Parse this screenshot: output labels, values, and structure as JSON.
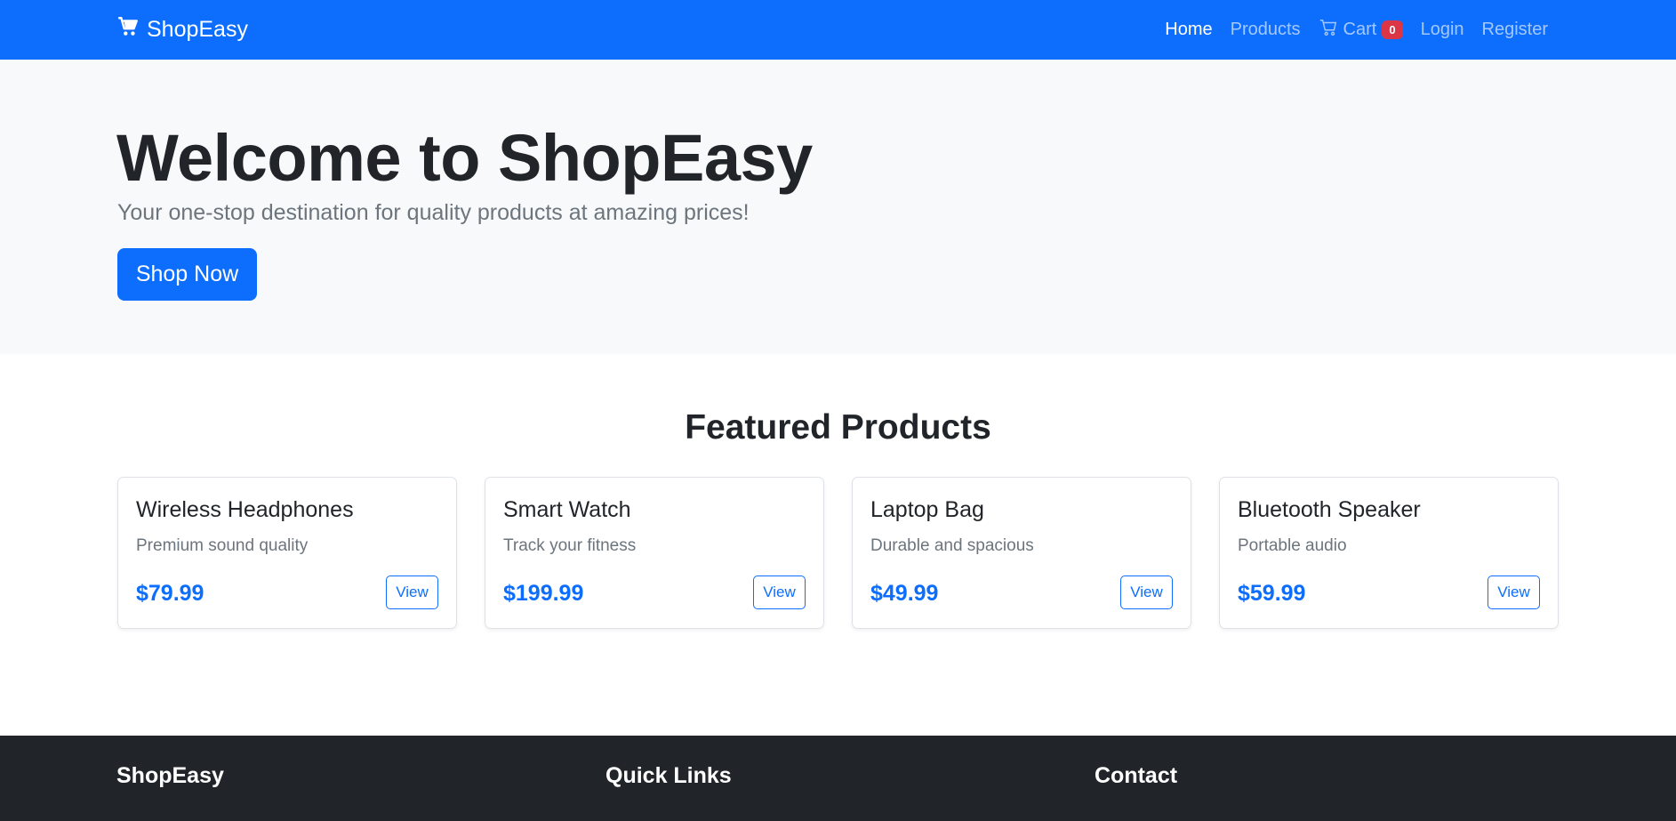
{
  "navbar": {
    "brand": "ShopEasy",
    "links": [
      {
        "label": "Home",
        "active": true
      },
      {
        "label": "Products",
        "active": false
      },
      {
        "label": "Cart",
        "active": false,
        "badge": "0"
      },
      {
        "label": "Login",
        "active": false
      },
      {
        "label": "Register",
        "active": false
      }
    ]
  },
  "hero": {
    "title": "Welcome to ShopEasy",
    "subtitle": "Your one-stop destination for quality products at amazing prices!",
    "cta": "Shop Now"
  },
  "featured": {
    "title": "Featured Products",
    "products": [
      {
        "name": "Wireless Headphones",
        "desc": "Premium sound quality",
        "price": "$79.99",
        "button": "View"
      },
      {
        "name": "Smart Watch",
        "desc": "Track your fitness",
        "price": "$199.99",
        "button": "View"
      },
      {
        "name": "Laptop Bag",
        "desc": "Durable and spacious",
        "price": "$49.99",
        "button": "View"
      },
      {
        "name": "Bluetooth Speaker",
        "desc": "Portable audio",
        "price": "$59.99",
        "button": "View"
      }
    ]
  },
  "footer": {
    "col1": "ShopEasy",
    "col2": "Quick Links",
    "col3": "Contact"
  },
  "colors": {
    "primary": "#0d6efd",
    "danger": "#dc3545",
    "dark": "#212529",
    "light": "#f8f9fa"
  }
}
